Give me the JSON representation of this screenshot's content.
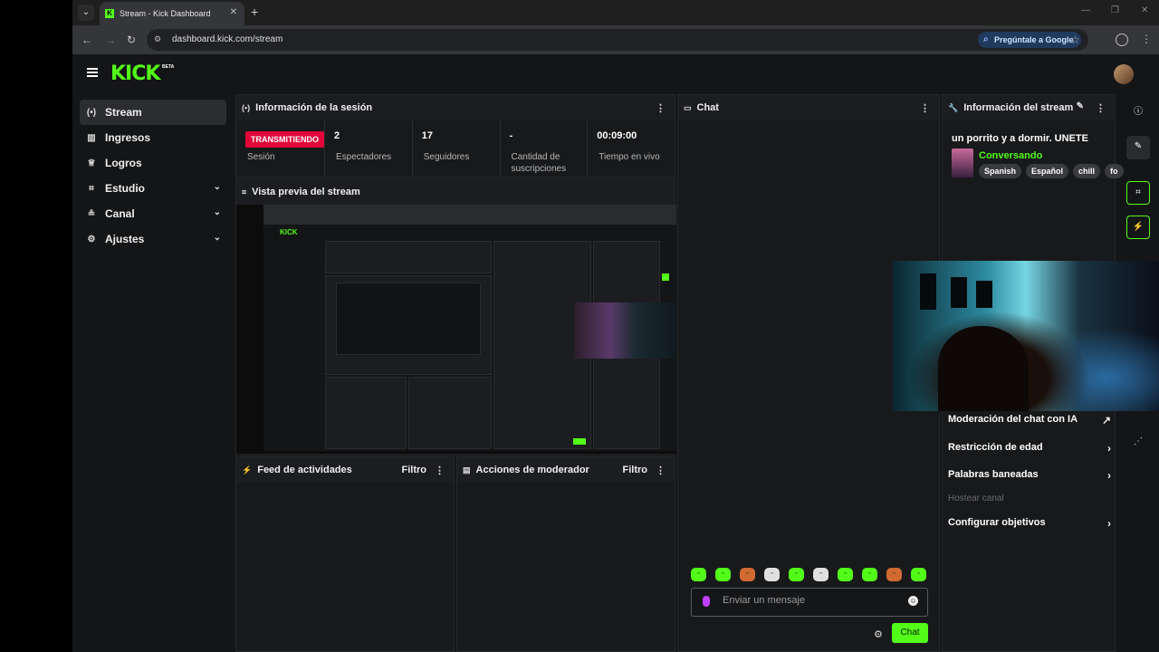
{
  "browser": {
    "tab_title": "Stream - Kick Dashboard",
    "tab_favicon": "K",
    "url": "dashboard.kick.com/stream",
    "ask_google": "Pregúntale a Google"
  },
  "app": {
    "logo": "KICK",
    "logo_badge": "BETA",
    "accent": "#53fc18",
    "live_color": "#e2063a"
  },
  "sidebar": {
    "items": [
      {
        "label": "Stream",
        "icon": "broadcast-icon",
        "glyph": "(•)",
        "active": true
      },
      {
        "label": "Ingresos",
        "icon": "chart-icon",
        "glyph": "▥"
      },
      {
        "label": "Logros",
        "icon": "trophy-icon",
        "glyph": "♕"
      },
      {
        "label": "Estudio",
        "icon": "studio-icon",
        "glyph": "⌗",
        "chevron": true
      },
      {
        "label": "Canal",
        "icon": "channel-icon",
        "glyph": "≗",
        "chevron": true
      },
      {
        "label": "Ajustes",
        "icon": "gear-icon",
        "glyph": "⚙",
        "chevron": true
      }
    ]
  },
  "session": {
    "title": "Información de la sesión",
    "stats": [
      {
        "value": "TRANSMITIENDO",
        "label": "Sesión"
      },
      {
        "value": "2",
        "label": "Espectadores"
      },
      {
        "value": "17",
        "label": "Seguidores"
      },
      {
        "value": "-",
        "label": "Cantidad de suscripciones"
      },
      {
        "value": "00:09:00",
        "label": "Tiempo en vivo"
      }
    ]
  },
  "preview": {
    "title": "Vista previa del stream"
  },
  "activity": {
    "title": "Feed de actividades",
    "filter": "Filtro"
  },
  "moderator": {
    "title": "Acciones de moderador",
    "filter": "Filtro"
  },
  "chat": {
    "title": "Chat",
    "placeholder": "Enviar un mensaje",
    "send_label": "Chat"
  },
  "stream_info": {
    "title": "Información del stream",
    "stream_title": "un porrito y a dormir. UNETE",
    "category": "Conversando",
    "tags": [
      "Spanish",
      "Español",
      "chill",
      "fo"
    ],
    "menu": [
      {
        "label": "Moderación del chat con IA",
        "icon": "external-icon"
      },
      {
        "label": "Restricción de edad",
        "icon": "chevron-right-icon"
      },
      {
        "label": "Palabras baneadas",
        "icon": "chevron-right-icon"
      },
      {
        "label": "Hostear canal",
        "disabled": true
      },
      {
        "label": "Configurar objetivos",
        "icon": "chevron-right-icon"
      }
    ]
  }
}
